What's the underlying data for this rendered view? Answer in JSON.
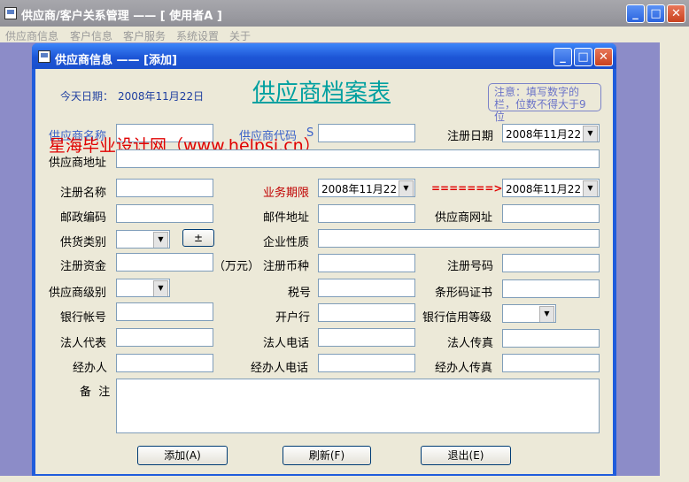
{
  "outer_window": {
    "title": "供应商/客户关系管理 —— [ 使用者A ]",
    "menu": [
      "供应商信息",
      "客户信息",
      "客户服务",
      "系统设置",
      "关于"
    ]
  },
  "child_window": {
    "title": "供应商信息 —— [添加]"
  },
  "form": {
    "today_label": "今天日期：",
    "today_value": "2008年11月22日",
    "heading": "供应商档案表",
    "note": "注意：填写数字的栏，位数不得大于9位",
    "watermark": "星海毕业设计网（www.helpsj.cn）",
    "labels": {
      "supplier_name": "供应商名称",
      "supplier_code": "供应商代码",
      "supplier_code_suffix": "S",
      "register_date": "注册日期",
      "supplier_address": "供应商地址",
      "register_name": "注册名称",
      "business_period": "业务期限",
      "period_arrow": "=======>>",
      "postal_code": "邮政编码",
      "mail_address": "邮件地址",
      "website": "供应商网址",
      "supply_category": "供货类别",
      "plusminus": "±",
      "company_nature": "企业性质",
      "capital": "注册资金",
      "capital_unit": "（万元）",
      "currency": "注册币种",
      "register_number": "注册号码",
      "supplier_level": "供应商级别",
      "tax_number": "税号",
      "barcode_cert": "条形码证书",
      "bank_account": "银行帐号",
      "bank": "开户行",
      "bank_credit": "银行信用等级",
      "legal_rep": "法人代表",
      "legal_phone": "法人电话",
      "legal_fax": "法人传真",
      "handler": "经办人",
      "handler_phone": "经办人电话",
      "handler_fax": "经办人传真",
      "remarks": "备  注"
    },
    "date_values": {
      "register_date": "2008年11月22日",
      "period_start": "2008年11月22日",
      "period_end": "2008年11月22日"
    },
    "buttons": {
      "add": "添加(A)",
      "refresh": "刷新(F)",
      "exit": "退出(E)"
    }
  },
  "colors": {
    "blue_label": "#3b62c9",
    "red_label": "#c00000",
    "watermark": "#e00000",
    "heading": "#00a0a0"
  },
  "icons": [
    "app-icon",
    "minimize-icon",
    "maximize-icon",
    "close-icon",
    "dropdown-arrow-icon"
  ]
}
